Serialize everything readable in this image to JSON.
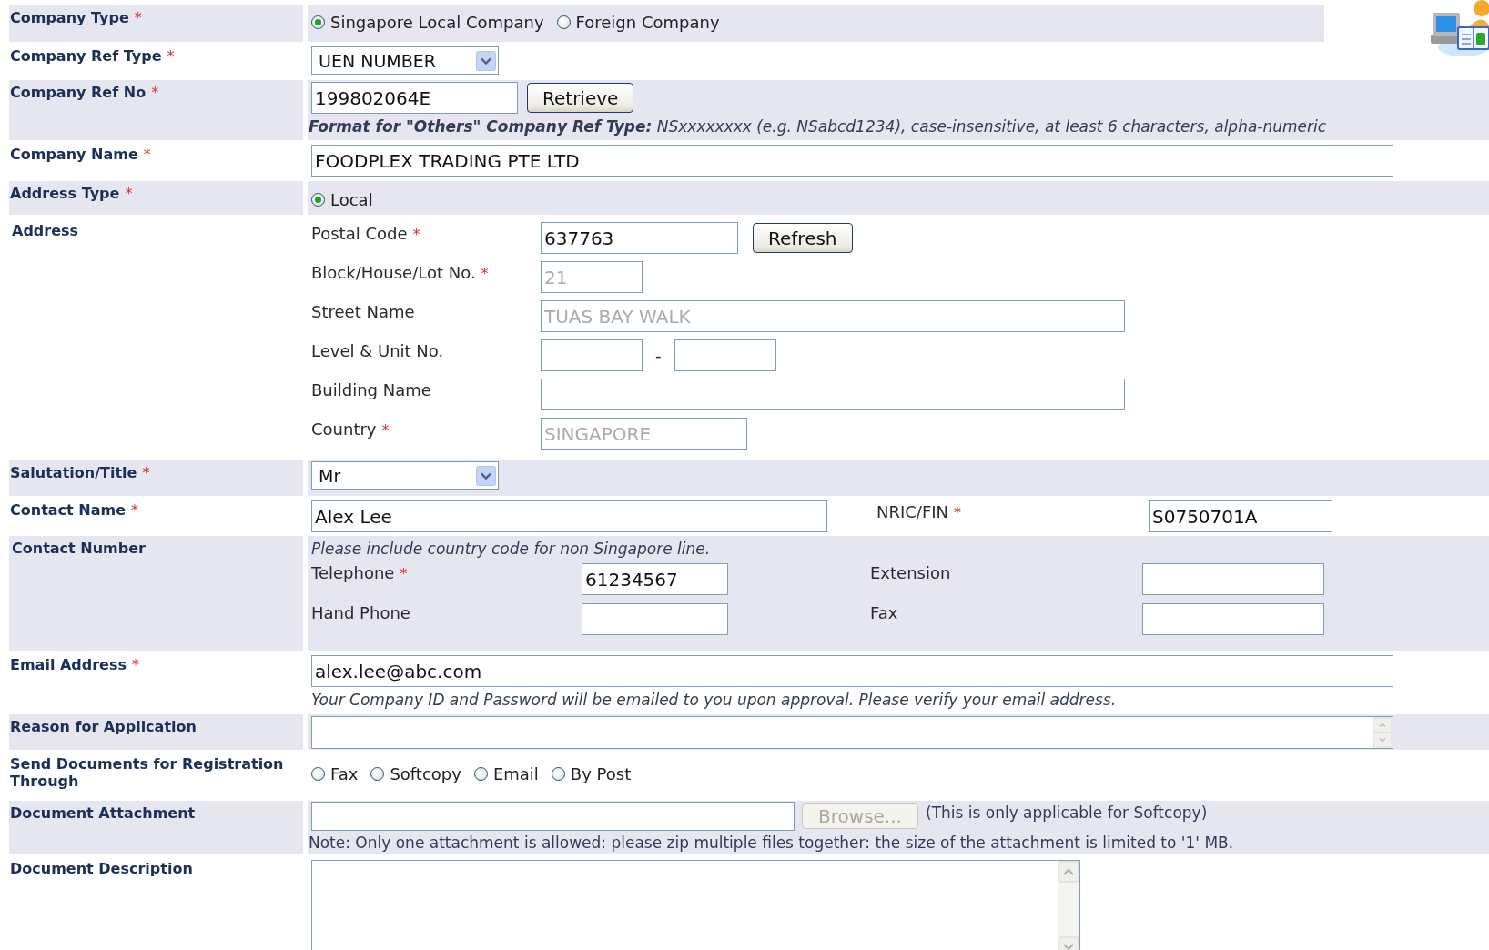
{
  "company_type": {
    "label": "Company Type",
    "mark": "*",
    "options": [
      {
        "label": "Singapore Local Company",
        "selected": true
      },
      {
        "label": "Foreign Company",
        "selected": false
      }
    ]
  },
  "company_ref_type": {
    "label": "Company Ref Type",
    "mark": "*",
    "value": "UEN NUMBER"
  },
  "company_ref_no": {
    "label": "Company Ref No",
    "mark": "*",
    "value": "199802064E",
    "button": "Retrieve",
    "hint": "**Format for \"Others\" Company Ref Type:** NSxxxxxxxx (e.g. NSabcd1234), case-insensitive, at least 6 characters, alpha-numeric"
  },
  "company_name": {
    "label": "Company Name",
    "mark": "*",
    "value": "FOODPLEX TRADING PTE LTD"
  },
  "address_type": {
    "label": "Address Type",
    "mark": "*",
    "options": [
      {
        "label": "Local",
        "selected": true
      }
    ]
  },
  "address": {
    "label": "Address",
    "fields": [
      {
        "kind": "medium",
        "label": "Postal Code",
        "mark": "*",
        "value": "637763",
        "disabled": false,
        "button": "Refresh"
      },
      {
        "kind": "short",
        "label": "Block/House/Lot No.",
        "mark": "*",
        "value": "21",
        "disabled": true
      },
      {
        "kind": "long",
        "label": "Street Name",
        "value": "TUAS BAY WALK",
        "disabled": true
      },
      {
        "kind": "pair",
        "label": "Level & Unit No.",
        "separator": "-"
      },
      {
        "kind": "long",
        "label": "Building Name"
      },
      {
        "kind": "medium",
        "label": "Country",
        "mark": "*",
        "value": "SINGAPORE",
        "disabled": true
      }
    ]
  },
  "salutation": {
    "label": "Salutation/Title",
    "mark": "*",
    "value": "Mr"
  },
  "contact_name": {
    "label": "Contact Name",
    "mark": "*",
    "value": "Alex Lee"
  },
  "nric": {
    "label": "NRIC/FIN",
    "mark": "*",
    "value": "S0750701A"
  },
  "contact_number": {
    "label": "Contact Number",
    "note": "Please include country code for non Singapore line.",
    "fields": [
      {
        "label": "Telephone",
        "mark": "*",
        "value": "61234567"
      },
      {
        "label": "Extension"
      },
      {
        "label": "Hand Phone"
      },
      {
        "label": "Fax"
      }
    ]
  },
  "email": {
    "label": "Email Address",
    "mark": "*",
    "value": "alex.lee@abc.com",
    "note": "Your Company ID and Password will be emailed to you upon approval. Please verify your email address."
  },
  "reason": {
    "label": "Reason for Application"
  },
  "send_documents": {
    "label": "Send Documents for Registration Through",
    "options": [
      {
        "label": "Fax",
        "selected": false
      },
      {
        "label": "Softcopy",
        "selected": false
      },
      {
        "label": "Email",
        "selected": false
      },
      {
        "label": "By Post",
        "selected": false
      }
    ]
  },
  "document_attachment": {
    "label": "Document Attachment",
    "button": "Browse...",
    "button_disabled": true,
    "aside": "(This is only applicable for Softcopy)",
    "note": "Note: Only one attachment is allowed: please zip multiple files together: the size of the attachment is limited to '1' MB."
  },
  "document_description": {
    "label": "Document Description"
  }
}
